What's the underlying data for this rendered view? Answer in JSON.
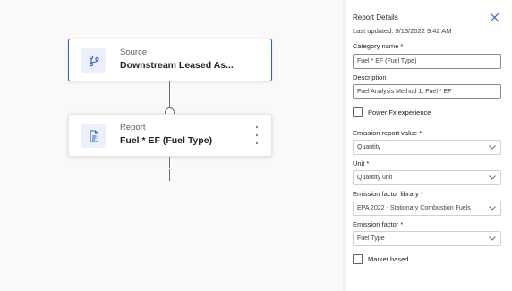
{
  "canvas": {
    "source_card": {
      "subtitle": "Source",
      "title": "Downstream Leased As...",
      "icon": "branch-icon"
    },
    "report_card": {
      "subtitle": "Report",
      "title": "Fuel * EF (Fuel Type)",
      "icon": "document-icon",
      "more_icon": "more-vertical-icon"
    },
    "add_icon": "plus-icon"
  },
  "panel": {
    "title": "Report Details",
    "last_updated": "Last updated: 9/13/2022 9:42 AM",
    "category_name": {
      "label": "Category name *",
      "value": "Fuel * EF (Fuel Type)"
    },
    "description": {
      "label": "Description",
      "value": "Fuel Analysis Method 1: Fuel * EF"
    },
    "power_fx": {
      "label": "Power Fx experience",
      "checked": false
    },
    "emission_report_value": {
      "label": "Emission report value *",
      "value": "Quantity"
    },
    "unit": {
      "label": "Unit *",
      "value": "Quantity unit"
    },
    "emission_factor_library": {
      "label": "Emission factor library *",
      "value": "EPA 2022 - Stationary Combustion Fuels"
    },
    "emission_factor": {
      "label": "Emission factor *",
      "value": "Fuel Type"
    },
    "market_based": {
      "label": "Market based",
      "checked": false
    }
  },
  "colors": {
    "accent": "#2b63c6",
    "icon_bg": "#ebf0fb",
    "canvas_bg": "#faf9f8"
  }
}
